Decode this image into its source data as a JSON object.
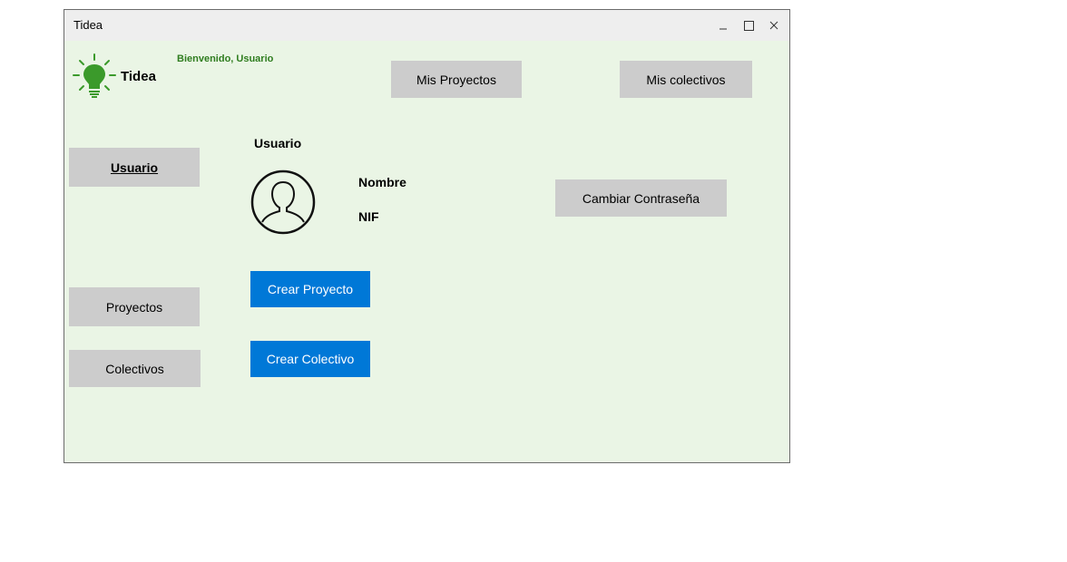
{
  "window": {
    "title": "Tidea",
    "controls": {
      "minimize_icon": "minimize-icon",
      "maximize_icon": "maximize-icon",
      "close_icon": "close-icon"
    }
  },
  "header": {
    "logo_text": "Tidea",
    "welcome": "Bienvenido, Usuario",
    "mis_proyectos_label": "Mis Proyectos",
    "mis_colectivos_label": "Mis colectivos"
  },
  "sidebar": {
    "items": [
      {
        "label": "Usuario",
        "active": true
      },
      {
        "label": "Proyectos",
        "active": false
      },
      {
        "label": "Colectivos",
        "active": false
      }
    ]
  },
  "main": {
    "section_title": "Usuario",
    "avatar_icon": "user-avatar-icon",
    "nombre_label": "Nombre",
    "nif_label": "NIF",
    "cambiar_contrasena_label": "Cambiar Contraseña",
    "crear_proyecto_label": "Crear Proyecto",
    "crear_colectivo_label": "Crear Colectivo"
  },
  "colors": {
    "window_background": "#eaf5e5",
    "titlebar": "#eeeeee",
    "accent_blue": "#0078d7",
    "button_gray": "#cccccc",
    "brand_green": "#2f7d1f",
    "logo_bulb_green": "#3b9a2b"
  }
}
